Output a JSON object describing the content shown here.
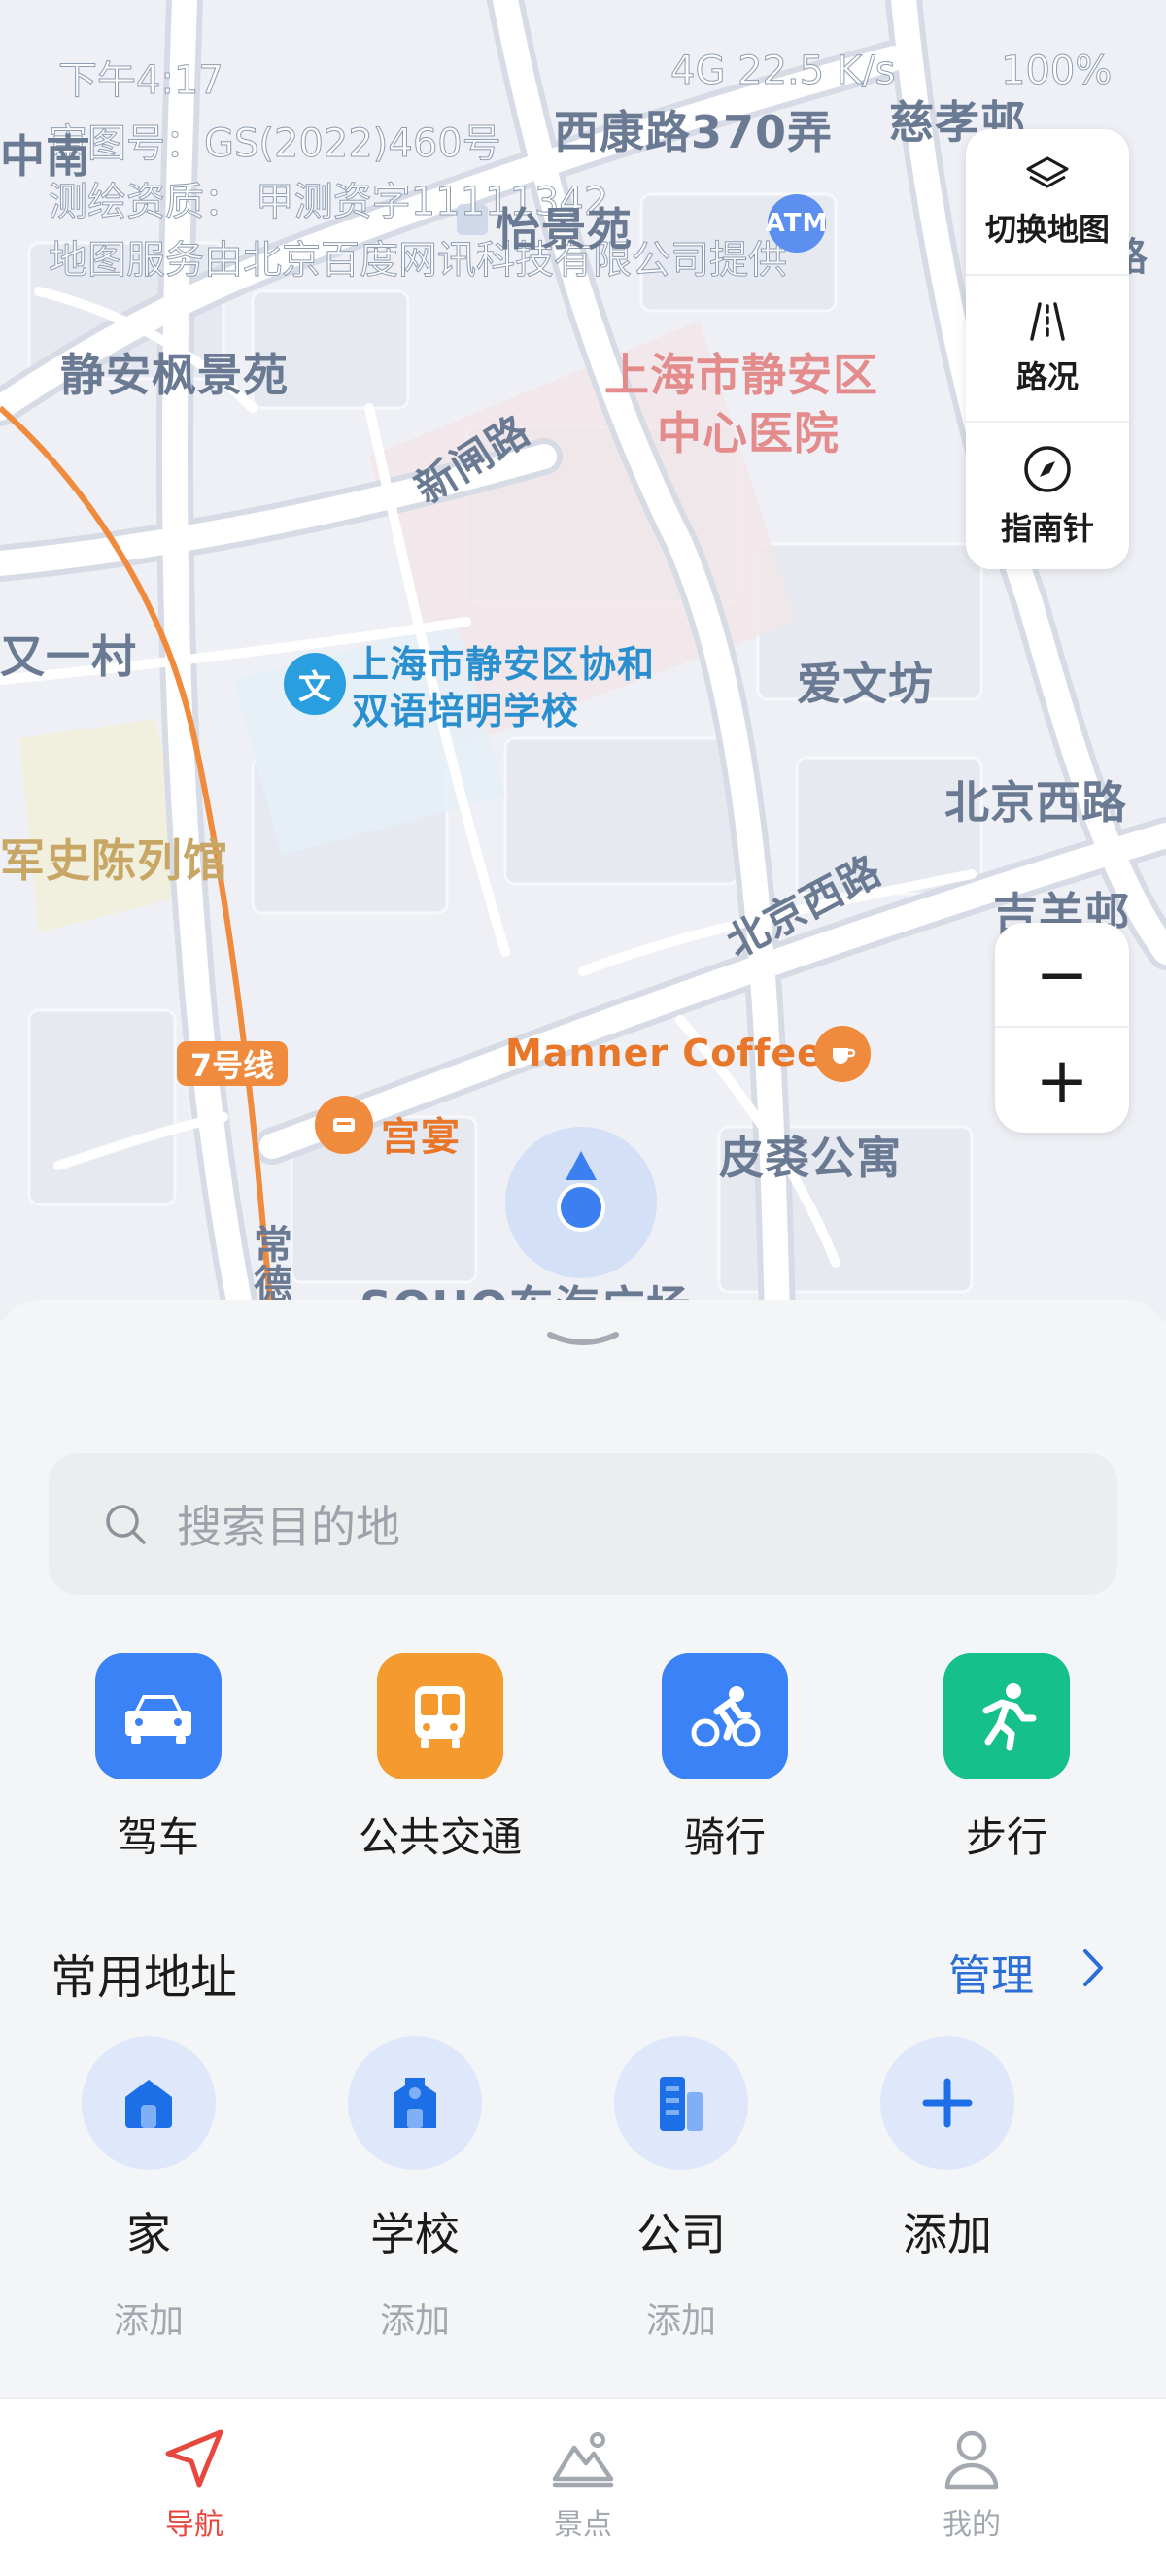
{
  "status_bar": {
    "time": "下午4:17",
    "network": "4G 22.5 K/s",
    "battery": "100%"
  },
  "map": {
    "copyright": {
      "line1": "审图号：GS(2022)460号",
      "line2": "测绘资质： 甲测资字11111342",
      "line3": "地图服务由北京百度网讯科技有限公司提供"
    },
    "labels": {
      "xikang_road_370": "西康路370弄",
      "cixiao": "慈孝邨",
      "yijing": "怡景苑",
      "jingan_fengjing": "静安枫景苑",
      "hospital_line1": "上海市静安区",
      "hospital_line2": "中心医院",
      "xinwen_road": "新闸路",
      "youyi_village": "又一村",
      "school_line1": "上海市静安区协和",
      "school_line2": "双语培明学校",
      "aiwen": "爱文坊",
      "beijing_west_road_side": "北京西路",
      "history_museum": "军史陈列馆",
      "beijing_west_road": "北京西路",
      "jiyang": "吉羊邨",
      "line7": "7号线",
      "manner_coffee": "Manner Coffee",
      "gongyan": "宫宴",
      "pishuang": "皮裘公寓",
      "changde": "常德",
      "soho": "SOHO东海广场",
      "atm": "ATM",
      "zhong": "中南",
      "jiang_road": "江路"
    },
    "controls": {
      "switch_map": "切换地图",
      "traffic": "路况",
      "compass": "指南针",
      "zoom_out": "−",
      "zoom_in": "+"
    }
  },
  "search": {
    "placeholder": "搜索目的地"
  },
  "modes": [
    {
      "label": "驾车",
      "icon": "car-icon",
      "color": "#3b82f6"
    },
    {
      "label": "公共交通",
      "icon": "bus-icon",
      "color": "#f59a2e"
    },
    {
      "label": "骑行",
      "icon": "bike-icon",
      "color": "#3b82f6"
    },
    {
      "label": "步行",
      "icon": "walk-icon",
      "color": "#16c08a"
    }
  ],
  "favorites": {
    "title": "常用地址",
    "manage": "管理",
    "items": [
      {
        "name": "家",
        "sub": "添加",
        "icon": "home-icon"
      },
      {
        "name": "学校",
        "sub": "添加",
        "icon": "school-icon"
      },
      {
        "name": "公司",
        "sub": "添加",
        "icon": "office-icon"
      },
      {
        "name": "添加",
        "sub": "",
        "icon": "plus-icon"
      }
    ]
  },
  "tabs": [
    {
      "label": "导航",
      "icon": "navigation-icon",
      "active": true
    },
    {
      "label": "景点",
      "icon": "scenic-icon",
      "active": false
    },
    {
      "label": "我的",
      "icon": "profile-icon",
      "active": false
    }
  ],
  "colors": {
    "accent_red": "#e8473e",
    "link_blue": "#2b6fd6",
    "metro_line7": "#f08a3c"
  }
}
